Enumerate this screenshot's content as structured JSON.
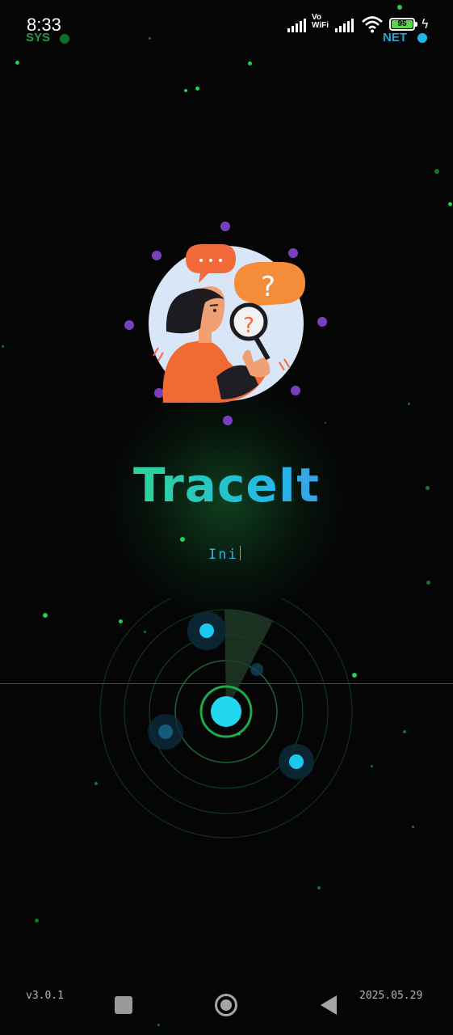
{
  "status_bar": {
    "time": "8:33",
    "sys_label": "SYS",
    "net_label": "NET",
    "vo_label": "Vo",
    "wifi_label": "WiFi",
    "battery_level": "95"
  },
  "app": {
    "title": "TraceIt",
    "status_text": "Ini",
    "version": "v3.0.1",
    "date": "2025.05.29"
  },
  "colors": {
    "background": "#050505",
    "title_gradient": [
      "#25ec6a",
      "#22b8e8",
      "#7a5fe0"
    ],
    "accent_cyan": "#22d8f0",
    "accent_green": "#1fcf4e"
  },
  "icons": {
    "illustration": "person-with-magnifying-glass-illustration",
    "radar": "radar-scanner-icon",
    "nav_recents": "square-icon",
    "nav_home": "circle-home-icon",
    "nav_back": "triangle-back-icon"
  }
}
